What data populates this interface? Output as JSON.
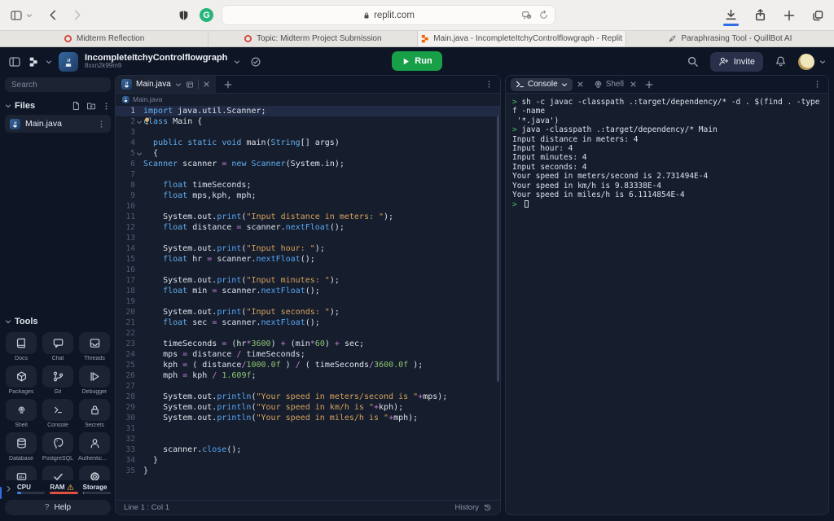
{
  "browser": {
    "toolbar": {
      "url": "replit.com"
    },
    "tabs": [
      {
        "label": "Midterm Reflection",
        "icon": "canvas-icon",
        "active": false
      },
      {
        "label": "Topic: Midterm Project Submission",
        "icon": "canvas-icon",
        "active": false
      },
      {
        "label": "Main.java - IncompleteItchyControlflowgraph - Replit",
        "icon": "replit-icon",
        "active": true
      },
      {
        "label": "Paraphrasing Tool - QuillBot AI",
        "icon": "quill-icon",
        "active": false
      }
    ]
  },
  "replit": {
    "header": {
      "title": "IncompleteItchyControlflowgraph",
      "subtitle": "8xxn2k99m9",
      "run_label": "Run",
      "invite_label": "Invite"
    },
    "sidebar": {
      "search_placeholder": "Search",
      "files_title": "Files",
      "files": [
        {
          "name": "Main.java"
        }
      ],
      "tools_title": "Tools",
      "tools": [
        {
          "icon": "docs-icon",
          "label": "Docs"
        },
        {
          "icon": "chat-icon",
          "label": "Chat"
        },
        {
          "icon": "threads-icon",
          "label": "Threads"
        },
        {
          "icon": "packages-icon",
          "label": "Packages"
        },
        {
          "icon": "git-icon",
          "label": "Git"
        },
        {
          "icon": "debugger-icon",
          "label": "Debugger"
        },
        {
          "icon": "shell-icon",
          "label": "Shell"
        },
        {
          "icon": "console-icon",
          "label": "Console"
        },
        {
          "icon": "secrets-icon",
          "label": "Secrets"
        },
        {
          "icon": "database-icon",
          "label": "Database"
        },
        {
          "icon": "postgresql-icon",
          "label": "PostgreSQL"
        },
        {
          "icon": "auth-icon",
          "label": "Authenticat..."
        },
        {
          "icon": "mplus-icon",
          "label": ""
        },
        {
          "icon": "check-icon",
          "label": ""
        },
        {
          "icon": "gear-icon",
          "label": ""
        }
      ],
      "meters": [
        {
          "label": "CPU",
          "fill_pct": 14,
          "color": "#3b82f6",
          "warning": false
        },
        {
          "label": "RAM",
          "fill_pct": 100,
          "color": "#e04f3f",
          "warning": true
        },
        {
          "label": "Storage",
          "fill_pct": 5,
          "color": "#8b93a7",
          "warning": false
        }
      ],
      "help_q": "?",
      "help_label": "Help"
    },
    "editor": {
      "tab_label": "Main.java",
      "breadcrumb": "Main.java",
      "status_left": "Line 1 : Col 1",
      "status_right": "History",
      "token_colors": {
        "kw": "#61afef",
        "ty": "#61afef",
        "fn": "#57a8f5",
        "st": "#d7a35c",
        "nu": "#8cc570",
        "op": "#c47fd6",
        "p": "#dde3ea"
      },
      "code_lines": [
        {
          "n": 1,
          "active": true,
          "t": [
            [
              "kw",
              "import"
            ],
            [
              "p",
              " java.util.Scanner;"
            ]
          ]
        },
        {
          "n": 2,
          "fold": true,
          "bulb": true,
          "t": [
            [
              "kw",
              "class"
            ],
            [
              "p",
              " Main {"
            ]
          ]
        },
        {
          "n": 3,
          "t": []
        },
        {
          "n": 4,
          "t": [
            [
              "p",
              "  "
            ],
            [
              "kw",
              "public static void"
            ],
            [
              "p",
              " main("
            ],
            [
              "ty",
              "String"
            ],
            [
              "p",
              "[] args)"
            ]
          ]
        },
        {
          "n": 5,
          "fold": true,
          "t": [
            [
              "p",
              "  {"
            ]
          ]
        },
        {
          "n": 6,
          "t": [
            [
              "ty",
              "Scanner"
            ],
            [
              "p",
              " scanner "
            ],
            [
              "op",
              "="
            ],
            [
              "p",
              " "
            ],
            [
              "kw",
              "new"
            ],
            [
              "p",
              " "
            ],
            [
              "ty",
              "Scanner"
            ],
            [
              "p",
              "(System.in);"
            ]
          ]
        },
        {
          "n": 7,
          "t": []
        },
        {
          "n": 8,
          "t": [
            [
              "p",
              "    "
            ],
            [
              "kw",
              "float"
            ],
            [
              "p",
              " timeSeconds;"
            ]
          ]
        },
        {
          "n": 9,
          "t": [
            [
              "p",
              "    "
            ],
            [
              "kw",
              "float"
            ],
            [
              "p",
              " mps,kph, mph;"
            ]
          ]
        },
        {
          "n": 10,
          "t": []
        },
        {
          "n": 11,
          "t": [
            [
              "p",
              "    System.out."
            ],
            [
              "fn",
              "print"
            ],
            [
              "p",
              "("
            ],
            [
              "st",
              "\"Input distance in meters: \""
            ],
            [
              "p",
              ");"
            ]
          ]
        },
        {
          "n": 12,
          "t": [
            [
              "p",
              "    "
            ],
            [
              "kw",
              "float"
            ],
            [
              "p",
              " distance "
            ],
            [
              "op",
              "="
            ],
            [
              "p",
              " scanner."
            ],
            [
              "fn",
              "nextFloat"
            ],
            [
              "p",
              "();"
            ]
          ]
        },
        {
          "n": 13,
          "t": []
        },
        {
          "n": 14,
          "t": [
            [
              "p",
              "    System.out."
            ],
            [
              "fn",
              "print"
            ],
            [
              "p",
              "("
            ],
            [
              "st",
              "\"Input hour: \""
            ],
            [
              "p",
              ");"
            ]
          ]
        },
        {
          "n": 15,
          "t": [
            [
              "p",
              "    "
            ],
            [
              "kw",
              "float"
            ],
            [
              "p",
              " hr "
            ],
            [
              "op",
              "="
            ],
            [
              "p",
              " scanner."
            ],
            [
              "fn",
              "nextFloat"
            ],
            [
              "p",
              "();"
            ]
          ]
        },
        {
          "n": 16,
          "t": []
        },
        {
          "n": 17,
          "t": [
            [
              "p",
              "    System.out."
            ],
            [
              "fn",
              "print"
            ],
            [
              "p",
              "("
            ],
            [
              "st",
              "\"Input minutes: \""
            ],
            [
              "p",
              ");"
            ]
          ]
        },
        {
          "n": 18,
          "t": [
            [
              "p",
              "    "
            ],
            [
              "kw",
              "float"
            ],
            [
              "p",
              " min "
            ],
            [
              "op",
              "="
            ],
            [
              "p",
              " scanner."
            ],
            [
              "fn",
              "nextFloat"
            ],
            [
              "p",
              "();"
            ]
          ]
        },
        {
          "n": 19,
          "t": []
        },
        {
          "n": 20,
          "t": [
            [
              "p",
              "    System.out."
            ],
            [
              "fn",
              "print"
            ],
            [
              "p",
              "("
            ],
            [
              "st",
              "\"Input seconds: \""
            ],
            [
              "p",
              ");"
            ]
          ]
        },
        {
          "n": 21,
          "t": [
            [
              "p",
              "    "
            ],
            [
              "kw",
              "float"
            ],
            [
              "p",
              " sec "
            ],
            [
              "op",
              "="
            ],
            [
              "p",
              " scanner."
            ],
            [
              "fn",
              "nextFloat"
            ],
            [
              "p",
              "();"
            ]
          ]
        },
        {
          "n": 22,
          "t": []
        },
        {
          "n": 23,
          "t": [
            [
              "p",
              "    timeSeconds "
            ],
            [
              "op",
              "="
            ],
            [
              "p",
              " (hr"
            ],
            [
              "op",
              "*"
            ],
            [
              "nu",
              "3600"
            ],
            [
              "p",
              ") "
            ],
            [
              "op",
              "+"
            ],
            [
              "p",
              " (min"
            ],
            [
              "op",
              "*"
            ],
            [
              "nu",
              "60"
            ],
            [
              "p",
              ") "
            ],
            [
              "op",
              "+"
            ],
            [
              "p",
              " sec;"
            ]
          ]
        },
        {
          "n": 24,
          "t": [
            [
              "p",
              "    mps "
            ],
            [
              "op",
              "="
            ],
            [
              "p",
              " distance "
            ],
            [
              "op",
              "/"
            ],
            [
              "p",
              " timeSeconds;"
            ]
          ]
        },
        {
          "n": 25,
          "t": [
            [
              "p",
              "    kph "
            ],
            [
              "op",
              "="
            ],
            [
              "p",
              " ( distance"
            ],
            [
              "op",
              "/"
            ],
            [
              "nu",
              "1000.0f"
            ],
            [
              "p",
              " ) "
            ],
            [
              "op",
              "/"
            ],
            [
              "p",
              " ( timeSeconds"
            ],
            [
              "op",
              "/"
            ],
            [
              "nu",
              "3600.0f"
            ],
            [
              "p",
              " );"
            ]
          ]
        },
        {
          "n": 26,
          "t": [
            [
              "p",
              "    mph "
            ],
            [
              "op",
              "="
            ],
            [
              "p",
              " kph "
            ],
            [
              "op",
              "/"
            ],
            [
              "p",
              " "
            ],
            [
              "nu",
              "1.609f"
            ],
            [
              "p",
              ";"
            ]
          ]
        },
        {
          "n": 27,
          "t": []
        },
        {
          "n": 28,
          "t": [
            [
              "p",
              "    System.out."
            ],
            [
              "fn",
              "println"
            ],
            [
              "p",
              "("
            ],
            [
              "st",
              "\"Your speed in meters/second is \""
            ],
            [
              "op",
              "+"
            ],
            [
              "p",
              "mps);"
            ]
          ]
        },
        {
          "n": 29,
          "t": [
            [
              "p",
              "    System.out."
            ],
            [
              "fn",
              "println"
            ],
            [
              "p",
              "("
            ],
            [
              "st",
              "\"Your speed in km/h is \""
            ],
            [
              "op",
              "+"
            ],
            [
              "p",
              "kph);"
            ]
          ]
        },
        {
          "n": 30,
          "t": [
            [
              "p",
              "    System.out."
            ],
            [
              "fn",
              "println"
            ],
            [
              "p",
              "("
            ],
            [
              "st",
              "\"Your speed in miles/h is \""
            ],
            [
              "op",
              "+"
            ],
            [
              "p",
              "mph);"
            ]
          ]
        },
        {
          "n": 31,
          "t": []
        },
        {
          "n": 32,
          "t": []
        },
        {
          "n": 33,
          "t": [
            [
              "p",
              "    scanner."
            ],
            [
              "fn",
              "close"
            ],
            [
              "p",
              "();"
            ]
          ]
        },
        {
          "n": 34,
          "t": [
            [
              "p",
              "  }"
            ]
          ]
        },
        {
          "n": 35,
          "t": [
            [
              "p",
              "}"
            ]
          ]
        }
      ]
    },
    "console": {
      "tabs": [
        {
          "label": "Console",
          "icon": "console-icon",
          "active": true
        },
        {
          "label": "Shell",
          "icon": "shell-icon",
          "active": false
        }
      ],
      "lines": [
        {
          "prompt": true,
          "text": "sh -c javac -classpath .:target/dependency/* -d . $(find . -type f -name"
        },
        {
          "text": " '*.java')"
        },
        {
          "prompt": true,
          "text": "java -classpath .:target/dependency/* Main"
        },
        {
          "text": "Input distance in meters: 4"
        },
        {
          "text": "Input hour: 4"
        },
        {
          "text": "Input minutes: 4"
        },
        {
          "text": "Input seconds: 4"
        },
        {
          "text": "Your speed in meters/second is 2.731494E-4"
        },
        {
          "text": "Your speed in km/h is 9.83338E-4"
        },
        {
          "text": "Your speed in miles/h is 6.1114854E-4"
        },
        {
          "prompt": true,
          "cursor": true,
          "text": ""
        }
      ]
    }
  }
}
